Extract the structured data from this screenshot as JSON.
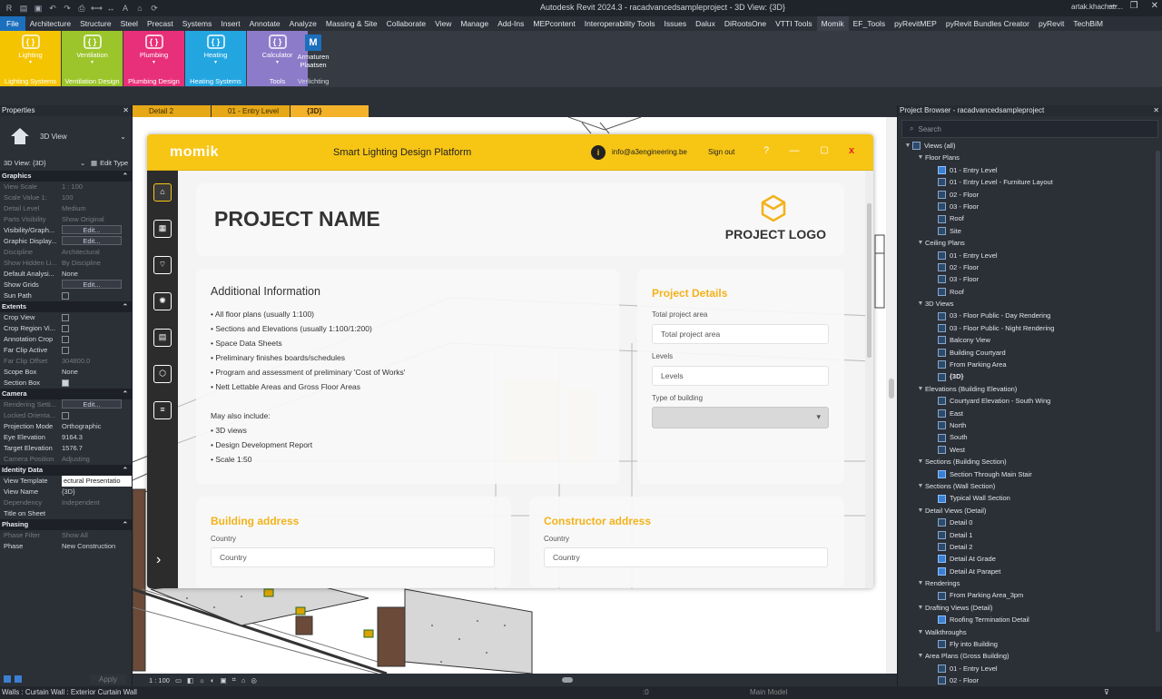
{
  "titlebar": {
    "app_title": "Autodesk Revit 2024.3 - racadvancedsampleproject - 3D View: {3D}",
    "user": "artak.khachatr...",
    "qat_icons": [
      "revit-logo-icon",
      "open-icon",
      "save-icon",
      "undo-icon",
      "redo-icon",
      "print-icon",
      "measure-icon",
      "dimension-icon",
      "text-icon",
      "home-icon",
      "sync-icon"
    ]
  },
  "menu": [
    "File",
    "Architecture",
    "Structure",
    "Steel",
    "Precast",
    "Systems",
    "Insert",
    "Annotate",
    "Analyze",
    "Massing & Site",
    "Collaborate",
    "View",
    "Manage",
    "Add-Ins",
    "MEPcontent",
    "Interoperability Tools",
    "Issues",
    "Dalux",
    "DiRootsOne",
    "VTTI Tools",
    "Momik",
    "EF_Tools",
    "pyRevitMEP",
    "pyRevit Bundles Creator",
    "pyRevit",
    "TechBiM"
  ],
  "ribbon": {
    "buttons": [
      {
        "label": "Lighting",
        "caption": "Lighting Systems",
        "color": "#f5c400"
      },
      {
        "label": "Ventilation",
        "caption": "Ventilation Design",
        "color": "#9bc52a"
      },
      {
        "label": "Plumbing",
        "caption": "Plumbing Design",
        "color": "#e8307a"
      },
      {
        "label": "Heating",
        "caption": "Heating Systems",
        "color": "#23a6e0"
      },
      {
        "label": "Calculator",
        "caption": "Tools",
        "color": "#8c7bc9"
      }
    ],
    "armaturen": {
      "icon": "M",
      "label1": "Armaturen",
      "label2": "Plaatsen",
      "caption": "Verlichting"
    }
  },
  "properties": {
    "title": "Properties",
    "type_name": "3D View",
    "instance_selector": "3D View: {3D}",
    "edit_type": "Edit Type",
    "sections": [
      {
        "name": "Graphics",
        "rows": [
          {
            "k": "View Scale",
            "v": "1 : 100",
            "dim": true
          },
          {
            "k": "Scale Value  1:",
            "v": "100",
            "dim": true
          },
          {
            "k": "Detail Level",
            "v": "Medium",
            "dim": true
          },
          {
            "k": "Parts Visibility",
            "v": "Show Original",
            "dim": true
          },
          {
            "k": "Visibility/Graph...",
            "v": "Edit...",
            "btn": true
          },
          {
            "k": "Graphic Display...",
            "v": "Edit...",
            "btn": true
          },
          {
            "k": "Discipline",
            "v": "Architectural",
            "dim": true
          },
          {
            "k": "Show Hidden Li...",
            "v": "By Discipline",
            "dim": true
          },
          {
            "k": "Default Analysi...",
            "v": "None"
          },
          {
            "k": "Show Grids",
            "v": "Edit...",
            "btn": true
          },
          {
            "k": "Sun Path",
            "v": "",
            "chk": false
          }
        ]
      },
      {
        "name": "Extents",
        "rows": [
          {
            "k": "Crop View",
            "v": "",
            "chk": false
          },
          {
            "k": "Crop Region Vi...",
            "v": "",
            "chk": false
          },
          {
            "k": "Annotation Crop",
            "v": "",
            "chk": false
          },
          {
            "k": "Far Clip Active",
            "v": "",
            "chk": false
          },
          {
            "k": "Far Clip Offset",
            "v": "304800.0",
            "dim": true
          },
          {
            "k": "Scope Box",
            "v": "None"
          },
          {
            "k": "Section Box",
            "v": "",
            "chk": true
          }
        ]
      },
      {
        "name": "Camera",
        "rows": [
          {
            "k": "Rendering Setti...",
            "v": "Edit...",
            "btn": true,
            "dim": true
          },
          {
            "k": "Locked Orienta...",
            "v": "",
            "chk": false,
            "dim": true
          },
          {
            "k": "Projection Mode",
            "v": "Orthographic"
          },
          {
            "k": "Eye Elevation",
            "v": "9164.3"
          },
          {
            "k": "Target Elevation",
            "v": "1576.7"
          },
          {
            "k": "Camera Position",
            "v": "Adjusting",
            "dim": true
          }
        ]
      },
      {
        "name": "Identity Data",
        "rows": [
          {
            "k": "View Template",
            "v": "ectural Presentatio",
            "box": true
          },
          {
            "k": "View Name",
            "v": "{3D}"
          },
          {
            "k": "Dependency",
            "v": "Independent",
            "dim": true
          },
          {
            "k": "Title on Sheet",
            "v": ""
          }
        ]
      },
      {
        "name": "Phasing",
        "rows": [
          {
            "k": "Phase Filter",
            "v": "Show All",
            "dim": true
          },
          {
            "k": "Phase",
            "v": "New Construction"
          }
        ]
      }
    ],
    "apply": "Apply"
  },
  "tabs": [
    {
      "label": "Detail 2"
    },
    {
      "label": "01 - Entry Level"
    },
    {
      "label": "{3D}",
      "current": true
    }
  ],
  "view_bar": {
    "scale": "1 : 100"
  },
  "status": {
    "text": "Walls : Curtain Wall : Exterior Curtain Wall",
    "model": "Main Model",
    "count": ":0"
  },
  "browser": {
    "title": "Project Browser - racadvancedsampleproject",
    "search_placeholder": "Search",
    "nodes": [
      {
        "d": 0,
        "t": "Views (all)",
        "tg": "▼",
        "ic": "views"
      },
      {
        "d": 1,
        "t": "Floor Plans",
        "tg": "▼"
      },
      {
        "d": 2,
        "t": "01 - Entry Level",
        "ic": "hl"
      },
      {
        "d": 2,
        "t": "01 - Entry Level - Furniture Layout",
        "ic": "v"
      },
      {
        "d": 2,
        "t": "02 - Floor",
        "ic": "v"
      },
      {
        "d": 2,
        "t": "03 - Floor",
        "ic": "v"
      },
      {
        "d": 2,
        "t": "Roof",
        "ic": "v"
      },
      {
        "d": 2,
        "t": "Site",
        "ic": "v"
      },
      {
        "d": 1,
        "t": "Ceiling Plans",
        "tg": "▼"
      },
      {
        "d": 2,
        "t": "01 - Entry Level",
        "ic": "v"
      },
      {
        "d": 2,
        "t": "02 - Floor",
        "ic": "v"
      },
      {
        "d": 2,
        "t": "03 - Floor",
        "ic": "v"
      },
      {
        "d": 2,
        "t": "Roof",
        "ic": "v"
      },
      {
        "d": 1,
        "t": "3D Views",
        "tg": "▼"
      },
      {
        "d": 2,
        "t": "03 - Floor Public - Day Rendering",
        "ic": "v"
      },
      {
        "d": 2,
        "t": "03 - Floor Public - Night Rendering",
        "ic": "v"
      },
      {
        "d": 2,
        "t": "Balcony View",
        "ic": "v"
      },
      {
        "d": 2,
        "t": "Building Courtyard",
        "ic": "v"
      },
      {
        "d": 2,
        "t": "From Parking Area",
        "ic": "v"
      },
      {
        "d": 2,
        "t": "{3D}",
        "ic": "v",
        "bold": true
      },
      {
        "d": 1,
        "t": "Elevations (Building Elevation)",
        "tg": "▼"
      },
      {
        "d": 2,
        "t": "Courtyard Elevation - South Wing",
        "ic": "v"
      },
      {
        "d": 2,
        "t": "East",
        "ic": "v"
      },
      {
        "d": 2,
        "t": "North",
        "ic": "v"
      },
      {
        "d": 2,
        "t": "South",
        "ic": "v"
      },
      {
        "d": 2,
        "t": "West",
        "ic": "v"
      },
      {
        "d": 1,
        "t": "Sections (Building Section)",
        "tg": "▼"
      },
      {
        "d": 2,
        "t": "Section Through Main Stair",
        "ic": "hl"
      },
      {
        "d": 1,
        "t": "Sections (Wall Section)",
        "tg": "▼"
      },
      {
        "d": 2,
        "t": "Typical Wall Section",
        "ic": "hl"
      },
      {
        "d": 1,
        "t": "Detail Views (Detail)",
        "tg": "▼"
      },
      {
        "d": 2,
        "t": "Detail 0",
        "ic": "v"
      },
      {
        "d": 2,
        "t": "Detail 1",
        "ic": "v"
      },
      {
        "d": 2,
        "t": "Detail 2",
        "ic": "v"
      },
      {
        "d": 2,
        "t": "Detail At Grade",
        "ic": "hl"
      },
      {
        "d": 2,
        "t": "Detail At Parapet",
        "ic": "hl"
      },
      {
        "d": 1,
        "t": "Renderings",
        "tg": "▼"
      },
      {
        "d": 2,
        "t": "From Parking Area_3pm",
        "ic": "v"
      },
      {
        "d": 1,
        "t": "Drafting Views (Detail)",
        "tg": "▼"
      },
      {
        "d": 2,
        "t": "Roofing Termination Detail",
        "ic": "hl"
      },
      {
        "d": 1,
        "t": "Walkthroughs",
        "tg": "▼"
      },
      {
        "d": 2,
        "t": "Fly into Building",
        "ic": "v"
      },
      {
        "d": 1,
        "t": "Area Plans (Gross Building)",
        "tg": "▼"
      },
      {
        "d": 2,
        "t": "01 - Entry Level",
        "ic": "v"
      },
      {
        "d": 2,
        "t": "02 - Floor",
        "ic": "v"
      }
    ]
  },
  "momik": {
    "logo": "momik",
    "title": "Smart Lighting Design Platform",
    "account_initial": "i",
    "email": "info@a3engineering.be",
    "signout": "Sign out",
    "help": "?",
    "minimize": "—",
    "maximize": "▢",
    "close": "x",
    "sidebar_icons": [
      "project-icon",
      "floorplan-icon",
      "lamp-icon",
      "sun-icon",
      "report-icon",
      "export-icon",
      "settings-icon"
    ],
    "project_name": "PROJECT NAME",
    "project_logo": "PROJECT LOGO",
    "additional": {
      "title": "Additional Information",
      "items": [
        "• All floor plans (usually 1:100)",
        "• Sections and Elevations (usually 1:100/1:200)",
        "• Space Data Sheets",
        "• Preliminary finishes boards/schedules",
        "• Program and assessment of preliminary 'Cost of Works'",
        "• Nett Lettable Areas and Gross Floor Areas"
      ],
      "also_title": "May also include:",
      "also_items": [
        "• 3D views",
        "• Design Development Report",
        "• Scale 1:50"
      ]
    },
    "details": {
      "title": "Project Details",
      "area_label": "Total project area",
      "area_placeholder": "Total project area",
      "levels_label": "Levels",
      "levels_placeholder": "Levels",
      "type_label": "Type of building",
      "type_value": ""
    },
    "building_address": {
      "title": "Building address",
      "country_label": "Country",
      "country_placeholder": "Country"
    },
    "constructor_address": {
      "title": "Constructor address",
      "country_label": "Country",
      "country_placeholder": "Country"
    },
    "accent": "#f7c514"
  }
}
